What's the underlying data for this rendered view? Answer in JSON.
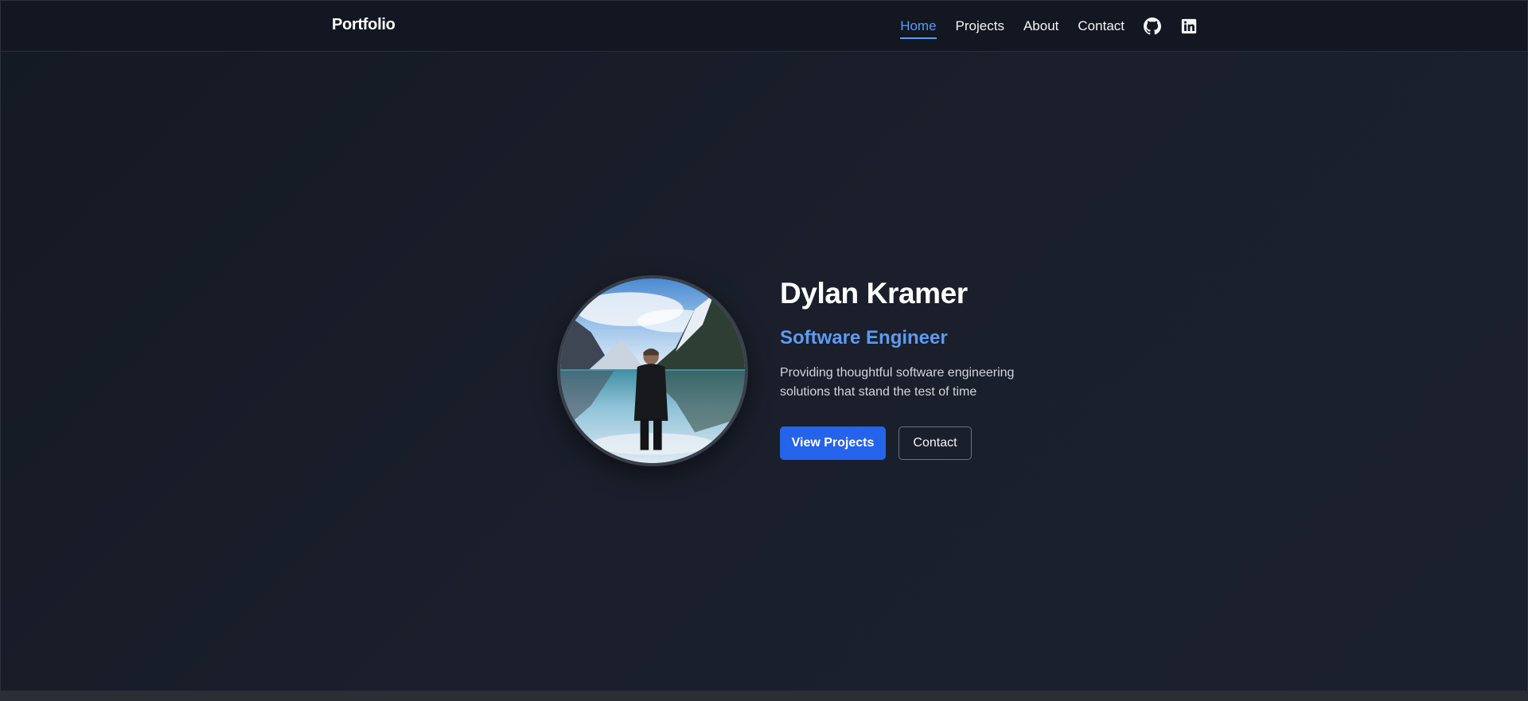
{
  "header": {
    "brand": "Portfolio",
    "nav": [
      {
        "label": "Home",
        "active": true
      },
      {
        "label": "Projects",
        "active": false
      },
      {
        "label": "About",
        "active": false
      },
      {
        "label": "Contact",
        "active": false
      }
    ],
    "icons": [
      "github-icon",
      "linkedin-icon"
    ]
  },
  "hero": {
    "name": "Dylan Kramer",
    "role": "Software Engineer",
    "tagline": "Providing thoughtful software engineering solutions that stand the test of time",
    "buttons": {
      "primary": "View Projects",
      "secondary": "Contact"
    }
  },
  "colors": {
    "accent": "#5b9bf2",
    "primary_button": "#2563eb",
    "background": "#171c27"
  }
}
